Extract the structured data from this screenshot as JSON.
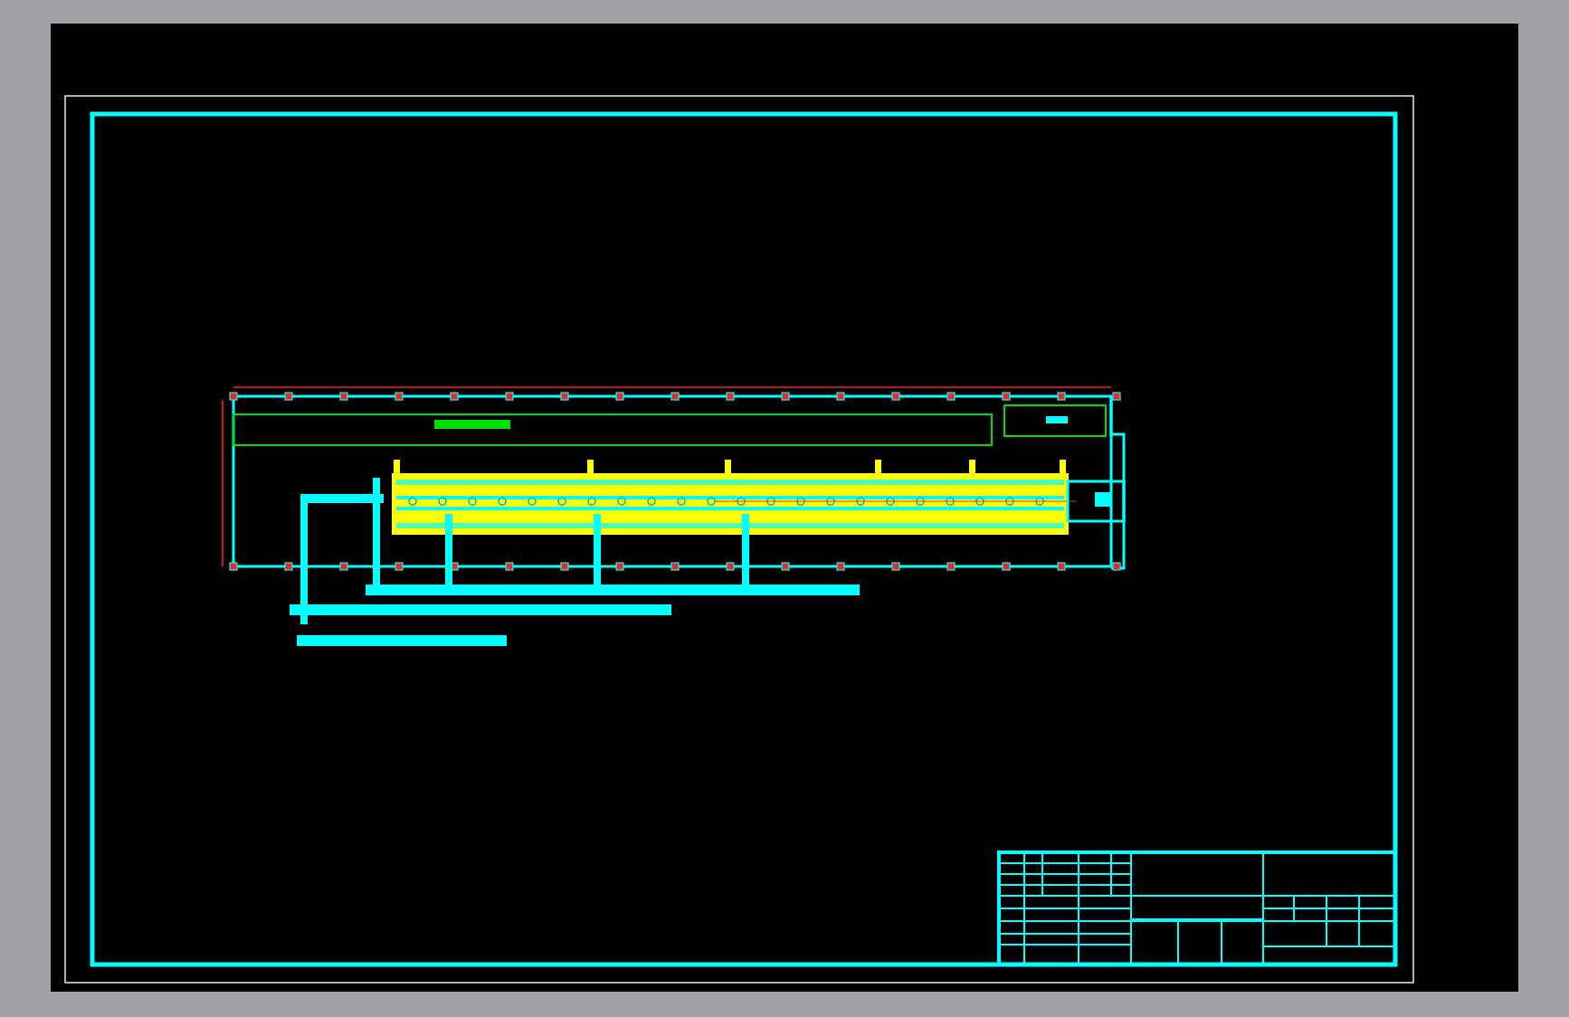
{
  "sheet": {
    "kind": "cad-drawing"
  }
}
